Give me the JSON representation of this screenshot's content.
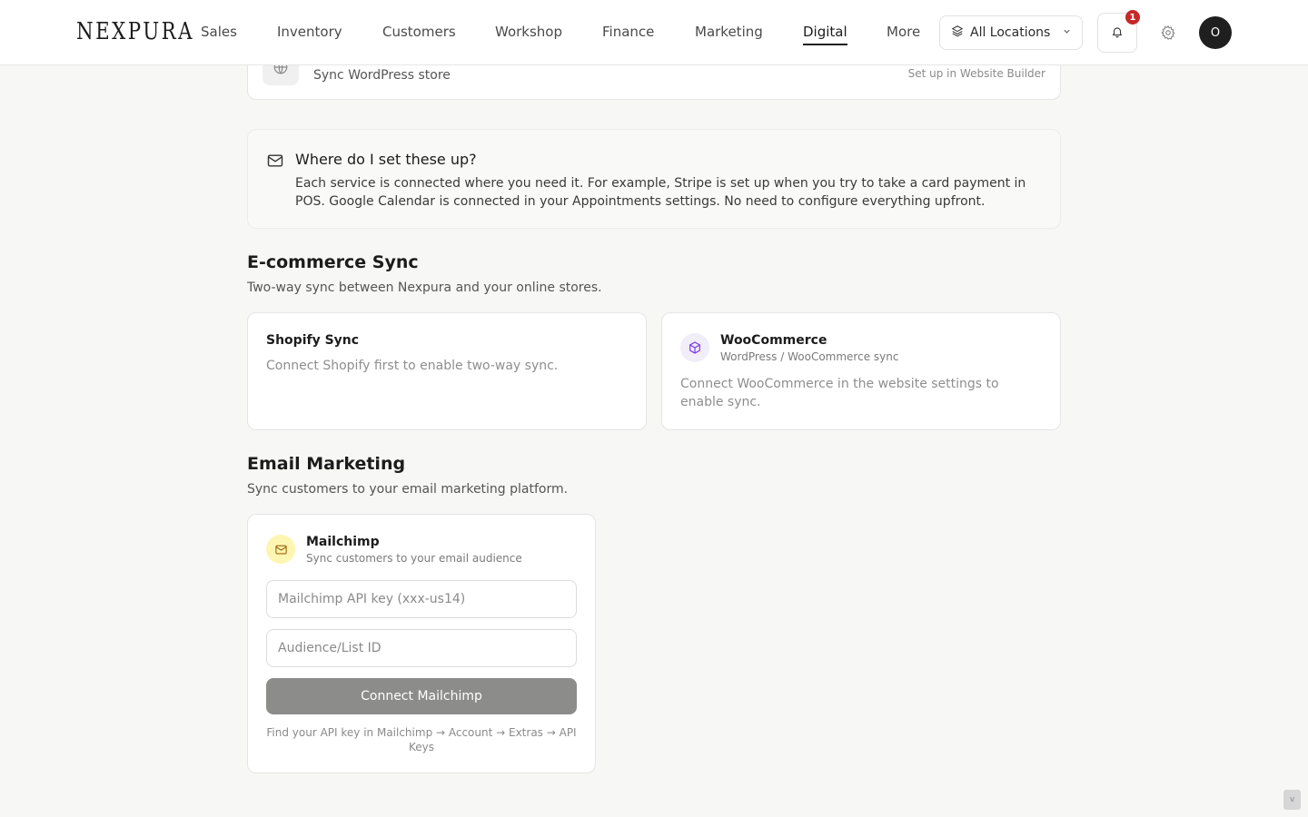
{
  "nav": {
    "brand": "NEXPURA",
    "items": [
      {
        "label": "Sales"
      },
      {
        "label": "Inventory"
      },
      {
        "label": "Customers"
      },
      {
        "label": "Workshop"
      },
      {
        "label": "Finance"
      },
      {
        "label": "Marketing"
      },
      {
        "label": "Digital",
        "active": true
      },
      {
        "label": "More"
      }
    ],
    "location_label": "All Locations",
    "notification_count": "1",
    "avatar_initial": "O"
  },
  "wordpress_card": {
    "subtitle": "Sync WordPress store",
    "action_link": "Set up in Website Builder",
    "icon": "globe-icon"
  },
  "info": {
    "title": "Where do I set these up?",
    "body": "Each service is connected where you need it. For example, Stripe is set up when you try to take a card payment in POS. Google Calendar is connected in your Appointments settings. No need to configure everything upfront.",
    "icon": "mail-icon"
  },
  "ecommerce": {
    "title": "E-commerce Sync",
    "subtitle": "Two-way sync between Nexpura and your online stores.",
    "shopify": {
      "title": "Shopify Sync",
      "body": "Connect Shopify first to enable two-way sync."
    },
    "woocommerce": {
      "title": "WooCommerce",
      "subtitle": "WordPress / WooCommerce sync",
      "body": "Connect WooCommerce in the website settings to enable sync.",
      "icon": "box-icon",
      "accent": "#7c3aed"
    }
  },
  "email_marketing": {
    "title": "Email Marketing",
    "subtitle": "Sync customers to your email marketing platform.",
    "mailchimp": {
      "title": "Mailchimp",
      "subtitle": "Sync customers to your email audience",
      "api_key_placeholder": "Mailchimp API key (xxx-us14)",
      "list_id_placeholder": "Audience/List ID",
      "connect_label": "Connect Mailchimp",
      "help": "Find your API key in Mailchimp → Account → Extras → API Keys",
      "icon": "mail-icon",
      "accent": "#fdf6b2"
    }
  },
  "scroll_label": "v"
}
